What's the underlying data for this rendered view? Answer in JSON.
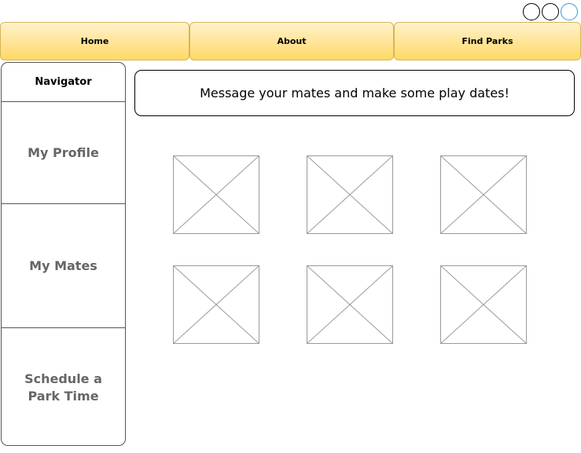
{
  "window_controls": [
    {
      "icon": "circle-icon"
    },
    {
      "icon": "circle-icon"
    },
    {
      "icon": "circle-icon",
      "color": "#3399dd"
    }
  ],
  "nav": {
    "tabs": [
      {
        "label": "Home"
      },
      {
        "label": "About"
      },
      {
        "label": "Find Parks"
      }
    ]
  },
  "sidebar": {
    "title": "Navigator",
    "items": [
      {
        "label": "My Profile"
      },
      {
        "label": "My Mates"
      },
      {
        "label": "Schedule a Park Time"
      }
    ]
  },
  "main": {
    "message": "Message your mates and make some play dates!",
    "image_placeholders": 6
  },
  "colors": {
    "tab_fill_top": "#fff2cc",
    "tab_fill_bottom": "#ffd966",
    "tab_border": "#d6b656"
  }
}
